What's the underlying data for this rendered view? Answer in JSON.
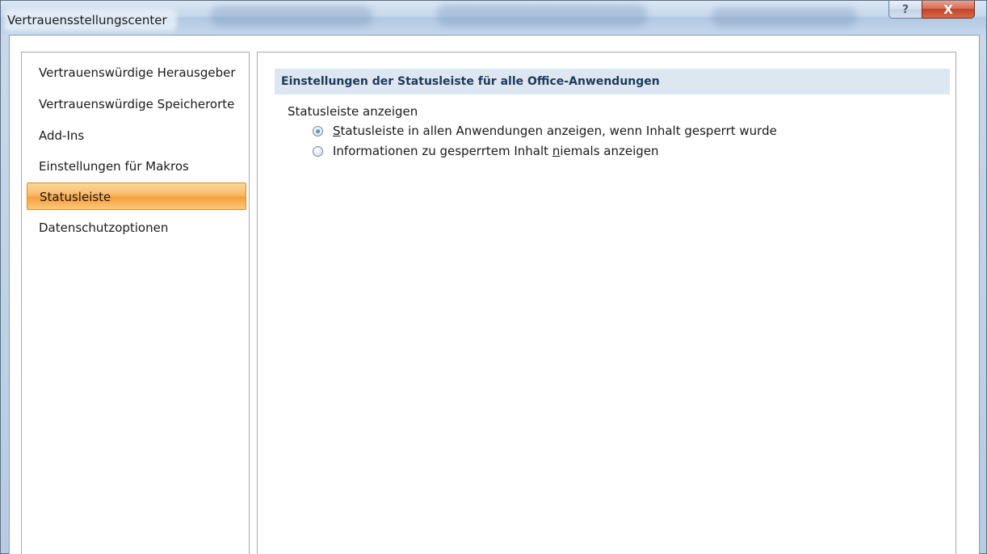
{
  "window": {
    "title": "Vertrauensstellungscenter",
    "help_glyph": "?",
    "close_glyph": "X"
  },
  "sidebar": {
    "items": [
      {
        "label": "Vertrauenswürdige Herausgeber",
        "selected": false
      },
      {
        "label": "Vertrauenswürdige Speicherorte",
        "selected": false
      },
      {
        "label": "Add-Ins",
        "selected": false
      },
      {
        "label": "Einstellungen für Makros",
        "selected": false
      },
      {
        "label": "Statusleiste",
        "selected": true
      },
      {
        "label": "Datenschutzoptionen",
        "selected": false
      }
    ]
  },
  "content": {
    "section_title": "Einstellungen der Statusleiste für alle Office-Anwendungen",
    "group_label": "Statusleiste anzeigen",
    "options": [
      {
        "label_before": "",
        "accel": "S",
        "label_after": "tatusleiste in allen Anwendungen anzeigen, wenn Inhalt gesperrt wurde",
        "checked": true
      },
      {
        "label_before": "Informationen zu gesperrtem Inhalt ",
        "accel": "n",
        "label_after": "iemals anzeigen",
        "checked": false
      }
    ]
  },
  "colors": {
    "selected_item": "#f9b967",
    "section_header_bg": "#dde7f2",
    "section_header_text": "#1e395b",
    "close_button": "#c4442a"
  }
}
